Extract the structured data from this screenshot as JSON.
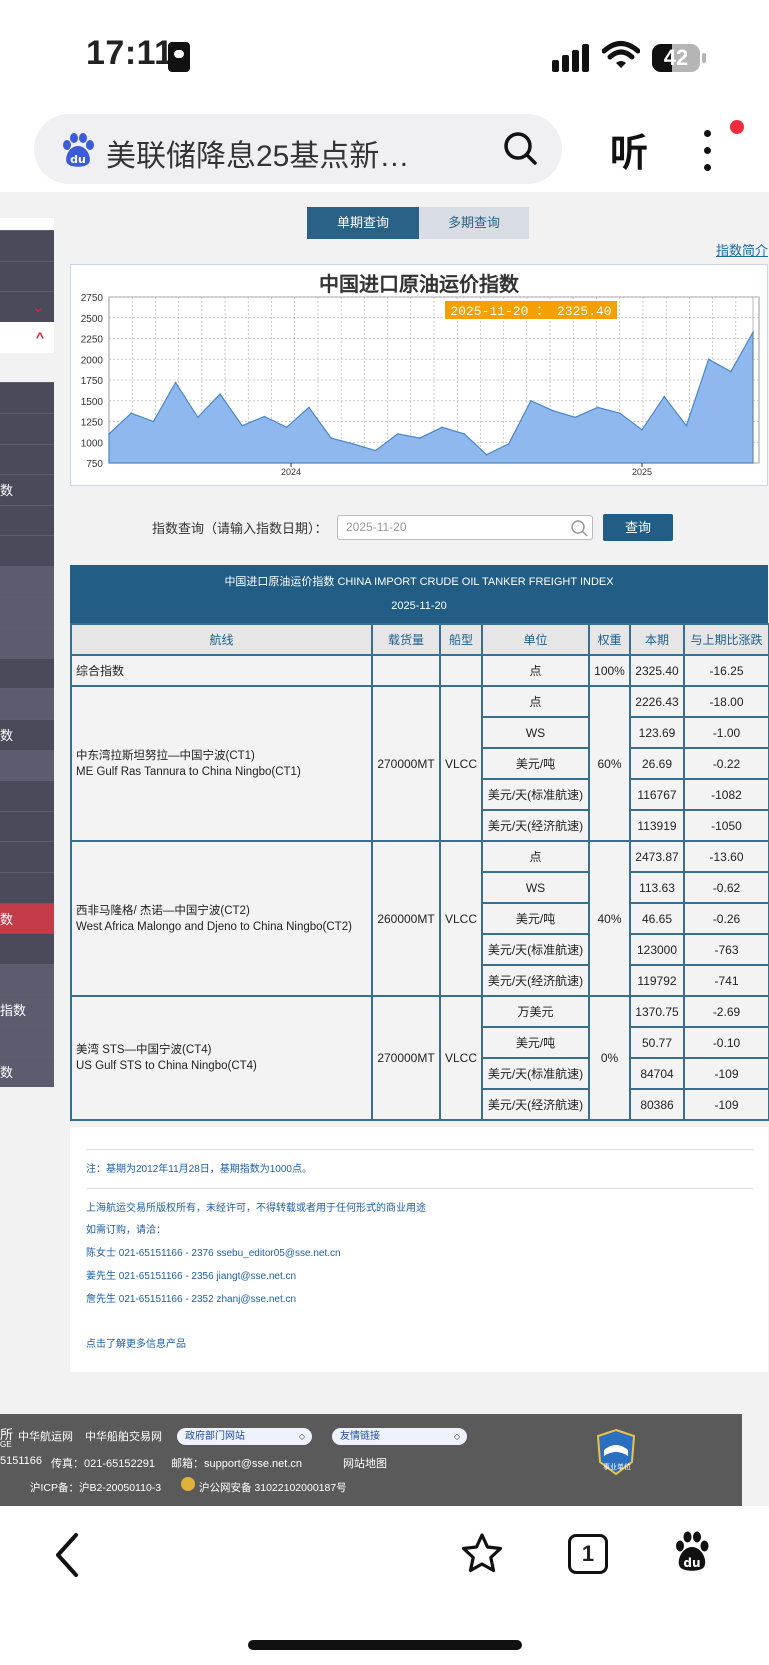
{
  "status_bar": {
    "time": "17:11",
    "battery": "42",
    "battery_level": 0.42
  },
  "browser": {
    "search_text": "美联储降息25基点新…",
    "listen_label": "听"
  },
  "tabs": {
    "single": "单期查询",
    "multi": "多期查询",
    "intro_link": "指数简介"
  },
  "sidebar": {
    "items": [
      {
        "label": ""
      },
      {
        "label": ""
      },
      {
        "label": "⌄"
      },
      {
        "label": "^"
      },
      {
        "label": ""
      },
      {
        "label": ""
      },
      {
        "label": ""
      },
      {
        "label": "数"
      },
      {
        "label": ""
      },
      {
        "label": ""
      },
      {
        "label": ""
      },
      {
        "label": ""
      },
      {
        "label": ""
      },
      {
        "label": ""
      },
      {
        "label": ""
      },
      {
        "label": "数"
      },
      {
        "label": ""
      },
      {
        "label": ""
      },
      {
        "label": ""
      },
      {
        "label": ""
      },
      {
        "label": ""
      },
      {
        "label": "数"
      },
      {
        "label": ""
      },
      {
        "label": ""
      },
      {
        "label": "指数"
      },
      {
        "label": ""
      },
      {
        "label": "数"
      }
    ]
  },
  "chart_data": {
    "type": "area",
    "title": "中国进口原油运价指数",
    "tooltip": "2025-11-20 ： 2325.40",
    "x_ticks": [
      "2024",
      "2025"
    ],
    "ylim": [
      750,
      2750
    ],
    "y_ticks": [
      "2750",
      "2500",
      "2250",
      "2000",
      "1750",
      "1500",
      "1250",
      "1000",
      "750"
    ],
    "grid": true,
    "accent_color": "#8fb9ee",
    "x": [
      "2023-06",
      "2023-07",
      "2023-08",
      "2023-09",
      "2023-10",
      "2023-11",
      "2023-12",
      "2024-01",
      "2024-02",
      "2024-03",
      "2024-04",
      "2024-05",
      "2024-06",
      "2024-07",
      "2024-08",
      "2024-09",
      "2024-10",
      "2024-11",
      "2024-12",
      "2025-01",
      "2025-02",
      "2025-03",
      "2025-04",
      "2025-05",
      "2025-06",
      "2025-07",
      "2025-08",
      "2025-09",
      "2025-10",
      "2025-11"
    ],
    "values": [
      1100,
      1350,
      1250,
      1720,
      1300,
      1580,
      1200,
      1310,
      1180,
      1420,
      1050,
      980,
      900,
      1100,
      1050,
      1180,
      1100,
      850,
      980,
      1500,
      1380,
      1300,
      1420,
      1350,
      1150,
      1550,
      1200,
      2000,
      1850,
      2325.4
    ]
  },
  "query": {
    "label": "指数查询（请输入指数日期）：",
    "placeholder": "2025-11-20",
    "button": "查询"
  },
  "table": {
    "title": "中国进口原油运价指数 CHINA IMPORT CRUDE OIL TANKER FREIGHT INDEX",
    "date": "2025-11-20",
    "headers": [
      "航线",
      "载货量",
      "船型",
      "单位",
      "权重",
      "本期",
      "与上期比涨跌"
    ],
    "composite": {
      "route": "综合指数",
      "unit": "点",
      "weight": "100%",
      "current": "2325.40",
      "change": "-16.25"
    },
    "routes": [
      {
        "name_cn": "中东湾拉斯坦努拉—中国宁波(CT1)",
        "name_en": "ME Gulf Ras Tannura to China Ningbo(CT1)",
        "capacity": "270000MT",
        "ship": "VLCC",
        "weight": "60%",
        "rows": [
          {
            "unit": "点",
            "current": "2226.43",
            "change": "-18.00"
          },
          {
            "unit": "WS",
            "current": "123.69",
            "change": "-1.00"
          },
          {
            "unit": "美元/吨",
            "current": "26.69",
            "change": "-0.22"
          },
          {
            "unit": "美元/天(标准航速)",
            "current": "116767",
            "change": "-1082"
          },
          {
            "unit": "美元/天(经济航速)",
            "current": "113919",
            "change": "-1050"
          }
        ]
      },
      {
        "name_cn": "西非马隆格/ 杰诺—中国宁波(CT2)",
        "name_en": "West Africa Malongo and Djeno to China Ningbo(CT2)",
        "capacity": "260000MT",
        "ship": "VLCC",
        "weight": "40%",
        "rows": [
          {
            "unit": "点",
            "current": "2473.87",
            "change": "-13.60"
          },
          {
            "unit": "WS",
            "current": "113.63",
            "change": "-0.62"
          },
          {
            "unit": "美元/吨",
            "current": "46.65",
            "change": "-0.26"
          },
          {
            "unit": "美元/天(标准航速)",
            "current": "123000",
            "change": "-763"
          },
          {
            "unit": "美元/天(经济航速)",
            "current": "119792",
            "change": "-741"
          }
        ]
      },
      {
        "name_cn": "美湾 STS—中国宁波(CT4)",
        "name_en": "US Gulf STS to China Ningbo(CT4)",
        "capacity": "270000MT",
        "ship": "VLCC",
        "weight": "0%",
        "rows": [
          {
            "unit": "万美元",
            "current": "1370.75",
            "change": "-2.69"
          },
          {
            "unit": "美元/吨",
            "current": "50.77",
            "change": "-0.10"
          },
          {
            "unit": "美元/天(标准航速)",
            "current": "84704",
            "change": "-109"
          },
          {
            "unit": "美元/天(经济航速)",
            "current": "80386",
            "change": "-109"
          }
        ]
      }
    ]
  },
  "notes": {
    "base": "注：基期为2012年11月28日，基期指数为1000点。",
    "copyright": "上海航运交易所版权所有，未经许可，不得转载或者用于任何形式的商业用途",
    "subscribe": "如需订购，请洽：",
    "contact1": "陈女士 021-65151166 - 2376 ssebu_editor05@sse.net.cn",
    "contact2": "姜先生 021-65151166 - 2356 jiangt@sse.net.cn",
    "contact3": "詹先生 021-65151166 - 2352 zhanj@sse.net.cn",
    "more_link": "点击了解更多信息产品"
  },
  "footer": {
    "edge_top": "所",
    "edge_sub": "GE",
    "link1": "中华航运网",
    "link2": "中华船舶交易网",
    "select1": "政府部门网站",
    "select2": "友情链接",
    "phone": "5151166",
    "fax": "传真：021-65152291",
    "email": "邮箱：support@sse.net.cn",
    "sitemap": "网站地图",
    "icp": "沪ICP备：沪B2-20050110-3",
    "police": "沪公网安备 31022102000187号",
    "badge": "事业单位"
  },
  "bottom_bar": {
    "tab_count": "1"
  }
}
